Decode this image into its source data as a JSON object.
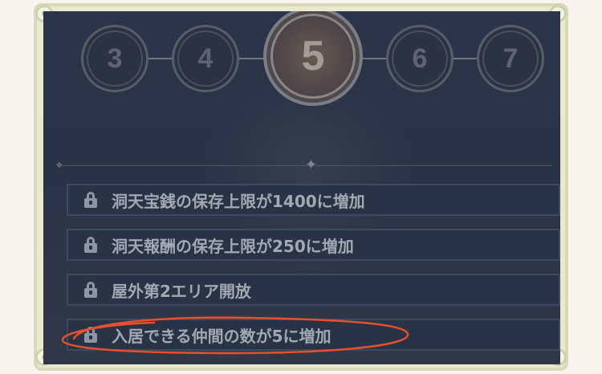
{
  "levels": [
    {
      "label": "3",
      "current": false
    },
    {
      "label": "4",
      "current": false
    },
    {
      "label": "5",
      "current": true
    },
    {
      "label": "6",
      "current": false
    },
    {
      "label": "7",
      "current": false
    }
  ],
  "perks": [
    {
      "text": "洞天宝銭の保存上限が1400に増加",
      "locked": true
    },
    {
      "text": "洞天報酬の保存上限が250に増加",
      "locked": true
    },
    {
      "text": "屋外第2エリア開放",
      "locked": true
    },
    {
      "text": "入居できる仲間の数が5に増加",
      "locked": true
    }
  ],
  "colors": {
    "annotation": "#e5512c",
    "panel_bg": "#2b3448",
    "frame": "#d8d9b9"
  }
}
